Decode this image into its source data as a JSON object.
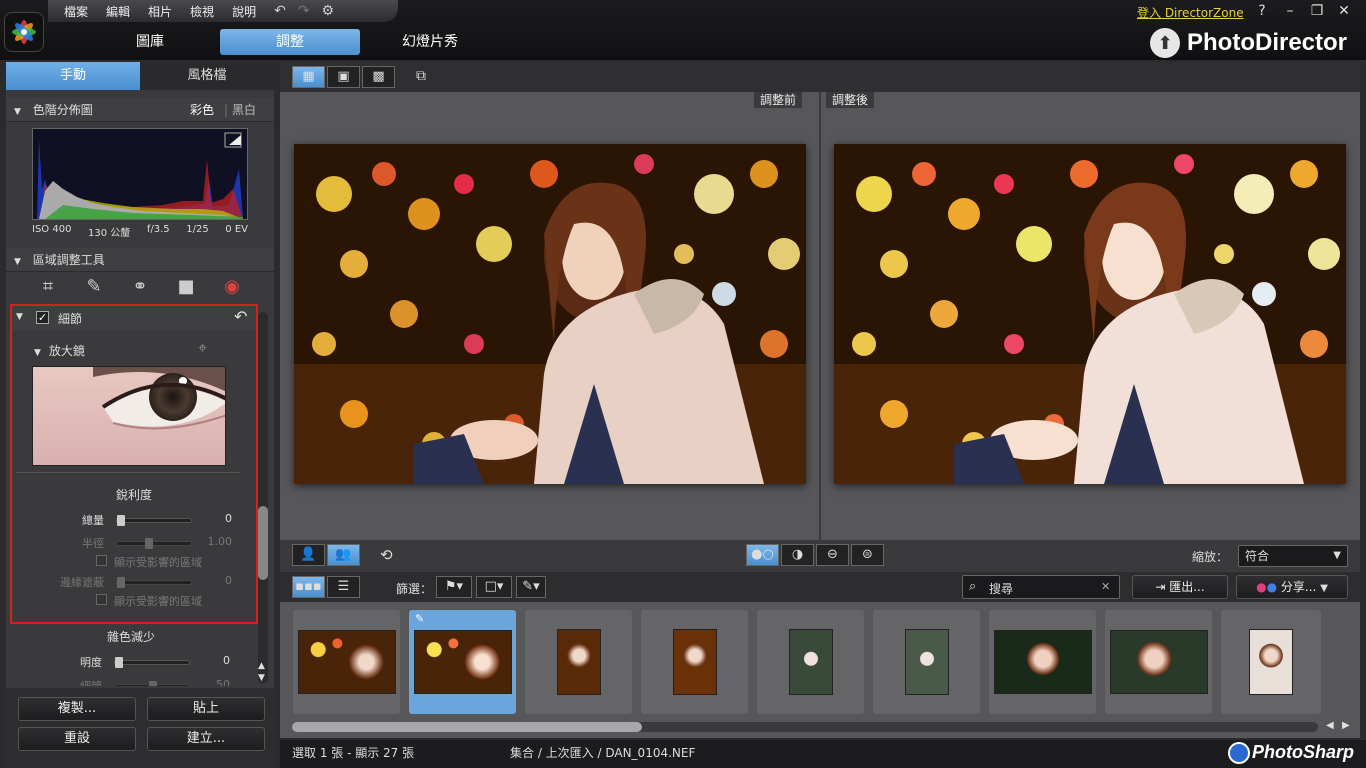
{
  "menu": {
    "items": [
      "檔案",
      "編輯",
      "相片",
      "檢視",
      "說明"
    ]
  },
  "modes": {
    "tabs": [
      "圖庫",
      "調整",
      "幻燈片秀"
    ],
    "active": 1
  },
  "header": {
    "login_link": "登入 DirectorZone",
    "help": "?",
    "brand": "PhotoDirector"
  },
  "left": {
    "tabs": [
      "手動",
      "風格檔"
    ],
    "histogram": {
      "title": "色階分佈圖",
      "color": "彩色",
      "bw": "黑白"
    },
    "exif": [
      "ISO 400",
      "130 公釐",
      "f/3.5",
      "1/25",
      "0 EV"
    ],
    "regional": {
      "title": "區域調整工具",
      "tools": [
        "crop-icon",
        "brush-icon",
        "gradient-icon",
        "radial-icon",
        "redeye-icon"
      ]
    },
    "detail": {
      "title": "細節",
      "magnifier": "放大鏡",
      "sharpness_title": "銳利度",
      "amount_label": "總量",
      "amount_value": "0",
      "radius_label": "半徑",
      "radius_value": "1.00",
      "show_affected_1": "顯示受影響的區域",
      "edge_mask_label": "邊緣遮蔽",
      "edge_mask_value": "0",
      "show_affected_2": "顯示受影響的區域"
    },
    "noise": {
      "title": "雜色減少",
      "luminance_label": "明度",
      "luminance_value": "0",
      "detail_label": "細節",
      "detail_value": "50"
    },
    "buttons": {
      "copy": "複製...",
      "paste": "貼上",
      "reset": "重設",
      "create": "建立..."
    }
  },
  "viewer": {
    "before": "調整前",
    "after": "調整後"
  },
  "bottom": {
    "zoom_label": "縮放：",
    "zoom_value": "符合"
  },
  "filter": {
    "label": "篩選：",
    "search_placeholder": "搜尋",
    "export": "匯出...",
    "share": "分享..."
  },
  "status": {
    "selection": "選取 1 張 - 顯示 27 張",
    "path": "集合 / 上次匯入 / DAN_0104.NEF",
    "watermark": "PhotoSharp"
  },
  "colors": {
    "accent": "#4a8fd0",
    "highlight_border": "#d42020",
    "link": "#e8d13a"
  }
}
